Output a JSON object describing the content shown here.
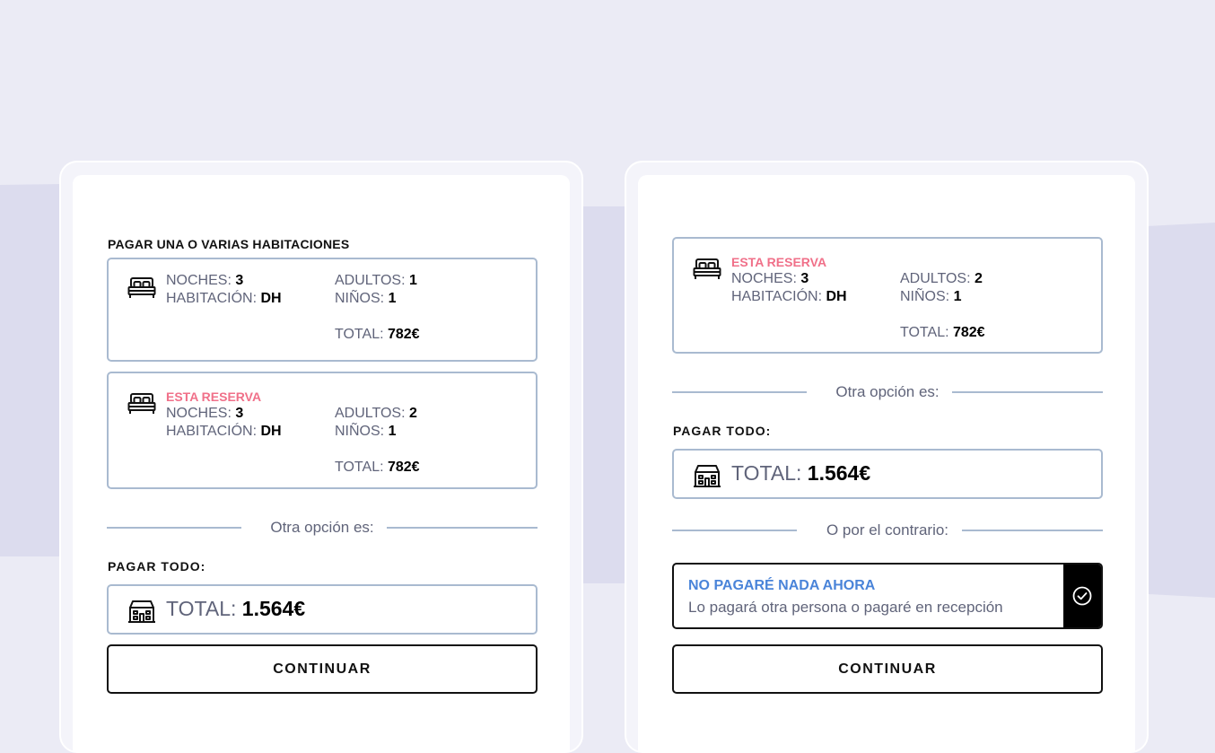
{
  "left_panel": {
    "section_title": "PAGAR UNA O VARIAS HABITACIONES",
    "rooms": [
      {
        "nights_label": "NOCHES:",
        "nights": "3",
        "room_label": "HABITACIÓN:",
        "room": "DH",
        "adults_label": "ADULTOS:",
        "adults": "1",
        "children_label": "NIÑOS:",
        "children": "1",
        "total_label": "TOTAL:",
        "total": "782€"
      },
      {
        "tag": "ESTA RESERVA",
        "nights_label": "NOCHES:",
        "nights": "3",
        "room_label": "HABITACIÓN:",
        "room": "DH",
        "adults_label": "ADULTOS:",
        "adults": "2",
        "children_label": "NIÑOS:",
        "children": "1",
        "total_label": "TOTAL:",
        "total": "782€"
      }
    ],
    "divider_text": "Otra opción es:",
    "pay_all_title": "PAGAR TODO:",
    "pay_all_total_label": "TOTAL:",
    "pay_all_total": "1.564€",
    "continue_label": "CONTINUAR"
  },
  "right_panel": {
    "room": {
      "tag": "ESTA RESERVA",
      "nights_label": "NOCHES:",
      "nights": "3",
      "room_label": "HABITACIÓN:",
      "room": "DH",
      "adults_label": "ADULTOS:",
      "adults": "2",
      "children_label": "NIÑOS:",
      "children": "1",
      "total_label": "TOTAL:",
      "total": "782€"
    },
    "divider_text": "Otra opción es:",
    "pay_all_title": "PAGAR TODO:",
    "pay_all_total_label": "TOTAL:",
    "pay_all_total": "1.564€",
    "divider2_text": "O por el contrario:",
    "no_pay_title": "NO PAGARÉ NADA AHORA",
    "no_pay_subtitle": "Lo pagará otra persona o pagaré en recepción",
    "continue_label": "CONTINUAR"
  },
  "icons": {
    "room": "bed-icon",
    "pay_all": "hotel-icon",
    "selected": "check-circle-icon"
  },
  "colors": {
    "background": "#ebebf5",
    "card_border": "#a9bad0",
    "tag": "#f07089",
    "link_blue": "#4a84d9",
    "text_muted": "#60647a",
    "text_strong": "#000000"
  }
}
